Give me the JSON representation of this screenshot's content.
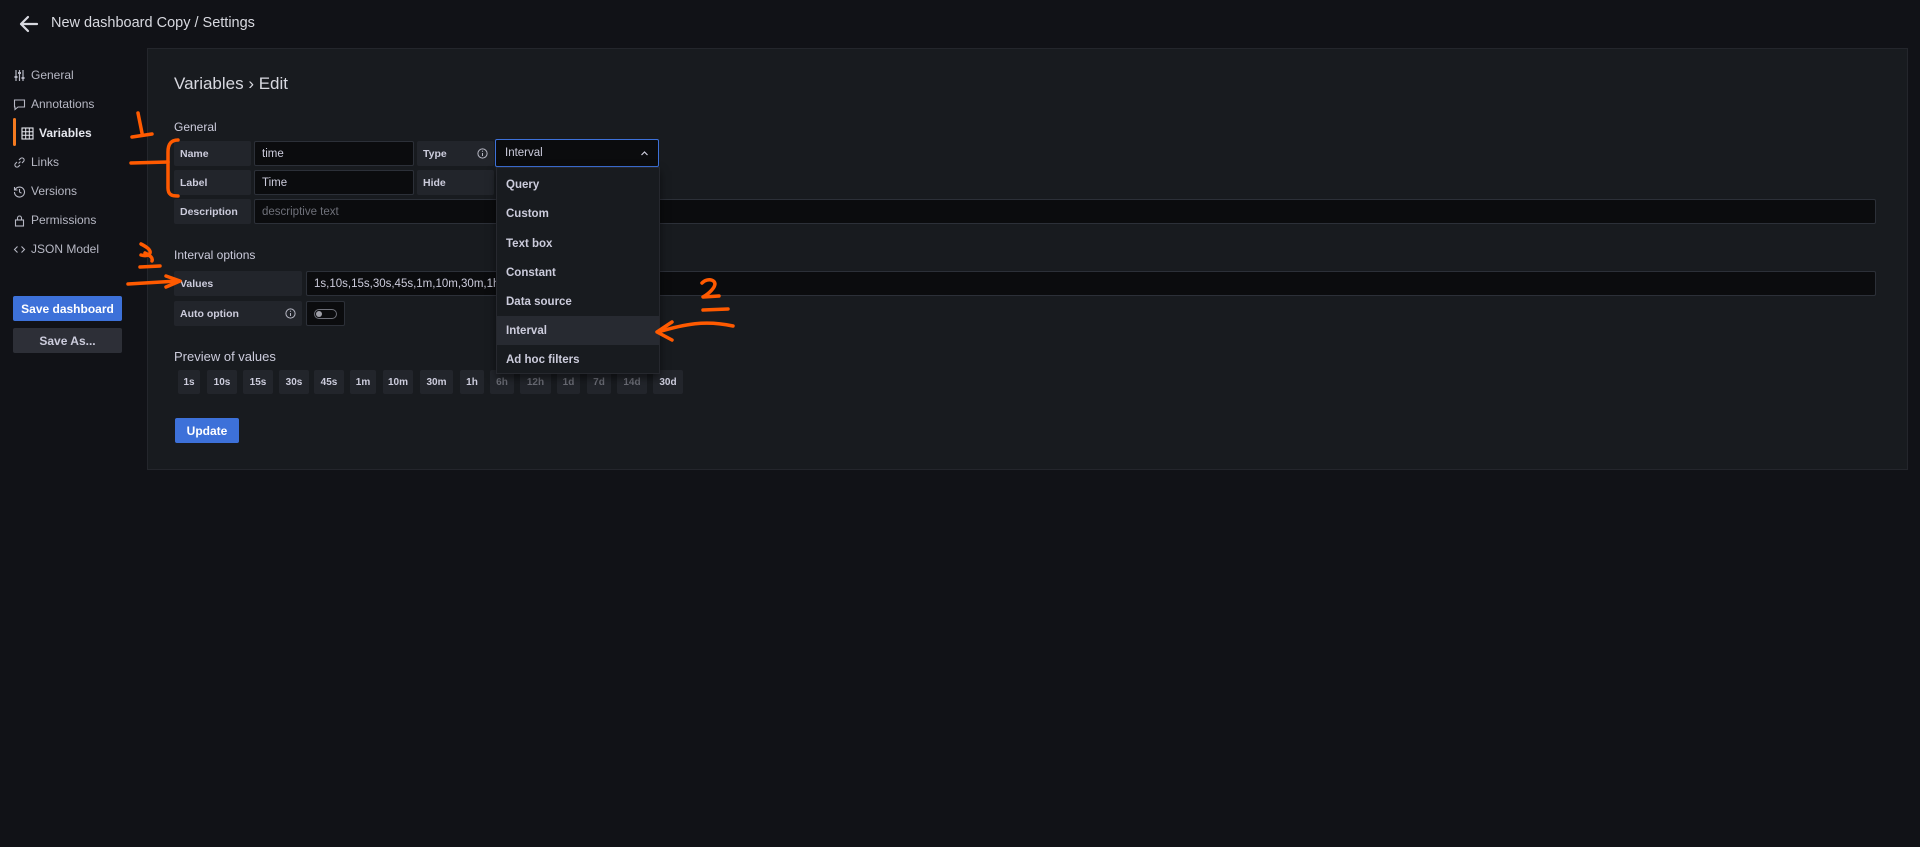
{
  "header": {
    "title": "New dashboard Copy / Settings"
  },
  "sidebar": {
    "items": [
      {
        "label": "General",
        "icon": "sliders-icon"
      },
      {
        "label": "Annotations",
        "icon": "comment-icon"
      },
      {
        "label": "Variables",
        "icon": "table-icon",
        "active": true
      },
      {
        "label": "Links",
        "icon": "link-icon"
      },
      {
        "label": "Versions",
        "icon": "history-icon"
      },
      {
        "label": "Permissions",
        "icon": "lock-icon"
      },
      {
        "label": "JSON Model",
        "icon": "code-icon"
      }
    ],
    "save_label": "Save dashboard",
    "save_as_label": "Save As..."
  },
  "editor": {
    "heading": "Variables › Edit",
    "general_label": "General",
    "name": {
      "label": "Name",
      "value": "time"
    },
    "type": {
      "label": "Type",
      "selected": "Interval"
    },
    "label": {
      "label": "Label",
      "value": "Time"
    },
    "hide": {
      "label": "Hide"
    },
    "description": {
      "label": "Description",
      "placeholder": "descriptive text"
    },
    "interval_options_label": "Interval options",
    "values": {
      "label": "Values",
      "value": "1s,10s,15s,30s,45s,1m,10m,30m,1h,6"
    },
    "auto_option": {
      "label": "Auto option",
      "enabled": false
    },
    "preview_label": "Preview of values",
    "preview_values": [
      "1s",
      "10s",
      "15s",
      "30s",
      "45s",
      "1m",
      "10m",
      "30m",
      "1h",
      "6h",
      "12h",
      "1d",
      "7d",
      "14d",
      "30d"
    ],
    "update_label": "Update"
  },
  "type_dropdown": {
    "options": [
      "Query",
      "Custom",
      "Text box",
      "Constant",
      "Data source",
      "Interval",
      "Ad hoc filters"
    ],
    "selected": "Interval"
  },
  "colors": {
    "accent": "#3d71d9",
    "active_marker": "#f47a20",
    "annotation": "#ff5a00"
  }
}
